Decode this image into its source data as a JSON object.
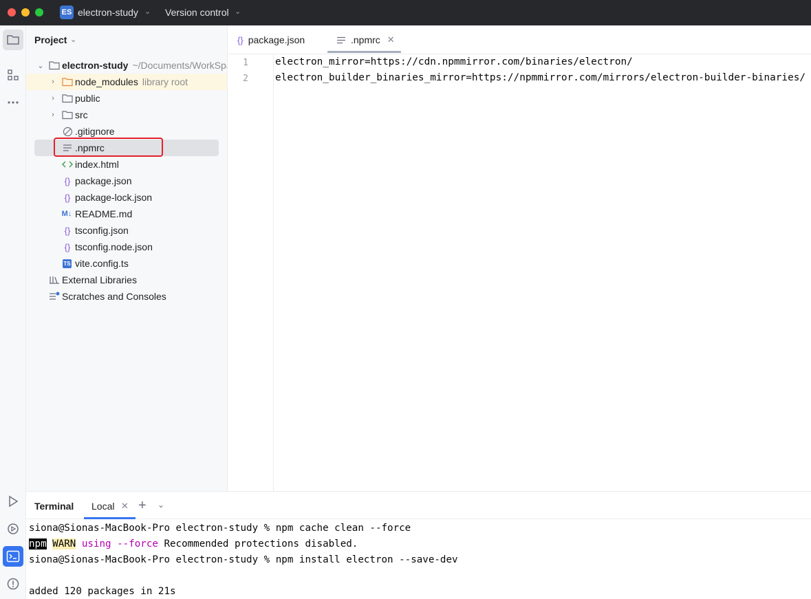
{
  "titlebar": {
    "project_badge": "ES",
    "project_name": "electron-study",
    "vcs_label": "Version control"
  },
  "project_panel": {
    "header": "Project",
    "root": {
      "label": "electron-study",
      "path_hint": "~/Documents/WorkSpa"
    },
    "items": [
      {
        "label": "node_modules",
        "hint": "library root",
        "icon": "folder-orange-icon"
      },
      {
        "label": "public",
        "icon": "folder-icon"
      },
      {
        "label": "src",
        "icon": "folder-icon"
      },
      {
        "label": ".gitignore",
        "icon": "ignore-icon"
      },
      {
        "label": ".npmrc",
        "icon": "text-file-icon"
      },
      {
        "label": "index.html",
        "icon": "html-icon"
      },
      {
        "label": "package.json",
        "icon": "json-icon"
      },
      {
        "label": "package-lock.json",
        "icon": "json-icon"
      },
      {
        "label": "README.md",
        "icon": "markdown-icon",
        "icon_text": "M↓"
      },
      {
        "label": "tsconfig.json",
        "icon": "json-icon"
      },
      {
        "label": "tsconfig.node.json",
        "icon": "json-icon"
      },
      {
        "label": "vite.config.ts",
        "icon": "typescript-icon",
        "icon_text": "TS"
      }
    ],
    "external_libraries": "External Libraries",
    "scratches": "Scratches and Consoles"
  },
  "editor": {
    "tabs": [
      {
        "label": "package.json",
        "icon": "json-icon"
      },
      {
        "label": ".npmrc",
        "icon": "text-file-icon",
        "active": true
      }
    ],
    "lines": [
      {
        "number": "1",
        "text": "electron_mirror=https://cdn.npmmirror.com/binaries/electron/"
      },
      {
        "number": "2",
        "text": "electron_builder_binaries_mirror=https://npmmirror.com/mirrors/electron-builder-binaries/"
      }
    ]
  },
  "terminal": {
    "title": "Terminal",
    "tab_label": "Local",
    "lines": {
      "l1": "siona@Sionas-MacBook-Pro electron-study % npm cache clean --force",
      "l2_npm": "npm",
      "l2_warn": "WARN",
      "l2_using": "using --force",
      "l2_rest": " Recommended protections disabled.",
      "l3": "siona@Sionas-MacBook-Pro electron-study % npm install electron --save-dev",
      "l5": "added 120 packages in 21s"
    }
  },
  "colors": {
    "titlebar_bg": "#27282c",
    "accent": "#3574f0",
    "selection_box": "#e4202c"
  }
}
